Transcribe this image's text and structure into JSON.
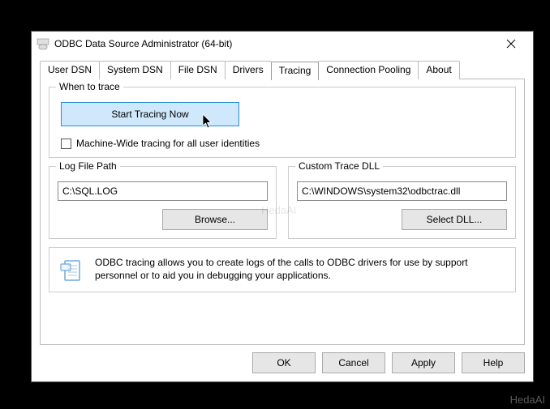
{
  "window": {
    "title": "ODBC Data Source Administrator (64-bit)"
  },
  "tabs": {
    "user_dsn": "User DSN",
    "system_dsn": "System DSN",
    "file_dsn": "File DSN",
    "drivers": "Drivers",
    "tracing": "Tracing",
    "connection_pooling": "Connection Pooling",
    "about": "About"
  },
  "tracing_panel": {
    "when_to_trace": {
      "legend": "When to trace",
      "start_button": "Start Tracing Now",
      "machine_wide_label": "Machine-Wide tracing for all user identities"
    },
    "log_file_path": {
      "legend": "Log File Path",
      "value": "C:\\SQL.LOG",
      "browse_label": "Browse..."
    },
    "custom_trace_dll": {
      "legend": "Custom Trace DLL",
      "value": "C:\\WINDOWS\\system32\\odbctrac.dll",
      "select_label": "Select DLL..."
    },
    "info_text": "ODBC tracing allows you to create logs of the calls to ODBC drivers for use by support personnel or to aid you in debugging your applications."
  },
  "buttons": {
    "ok": "OK",
    "cancel": "Cancel",
    "apply": "Apply",
    "help": "Help"
  },
  "watermark": "HedaAI"
}
